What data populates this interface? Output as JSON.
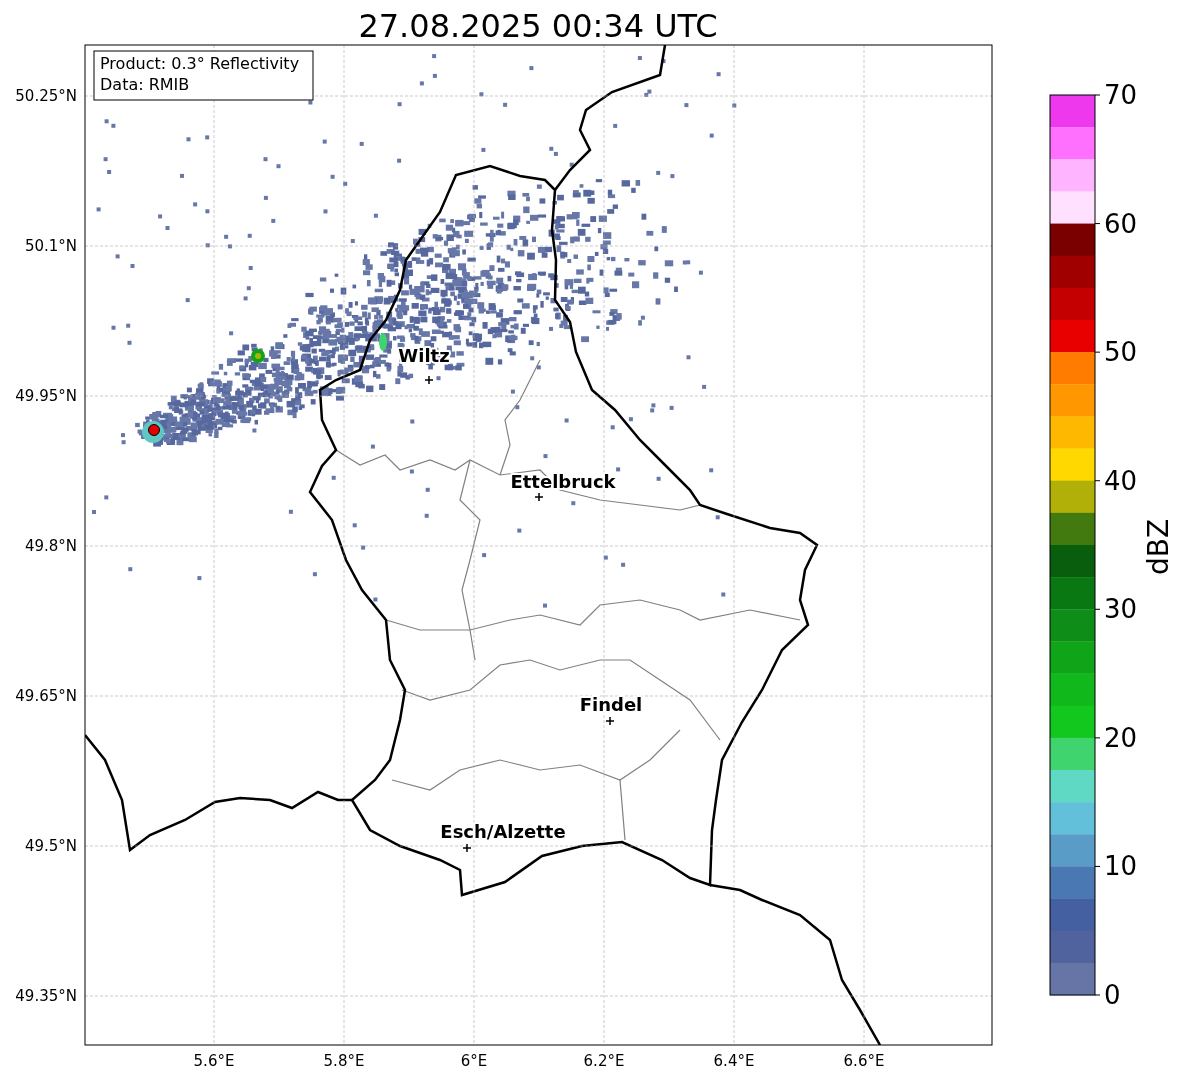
{
  "title": "27.08.2025 00:34 UTC",
  "legend": [
    "Product: 0.3° Reflectivity",
    "Data: RMIB"
  ],
  "map": {
    "lat_ticks": [
      "50.25°N",
      "50.1°N",
      "49.95°N",
      "49.8°N",
      "49.65°N",
      "49.5°N",
      "49.35°N"
    ],
    "lon_ticks": [
      "5.6°E",
      "5.8°E",
      "6°E",
      "6.2°E",
      "6.4°E",
      "6.6°E"
    ],
    "cities": [
      {
        "name": "Wiltz"
      },
      {
        "name": "Ettelbruck"
      },
      {
        "name": "Findel"
      },
      {
        "name": "Esch/Alzette"
      }
    ]
  },
  "colorbar": {
    "label": "dBZ",
    "ticks": [
      "70",
      "60",
      "50",
      "40",
      "30",
      "20",
      "10",
      "0"
    ],
    "bands": [
      {
        "color": "#ee38ee"
      },
      {
        "color": "#ff70ff"
      },
      {
        "color": "#ffb4ff"
      },
      {
        "color": "#ffe0ff"
      },
      {
        "color": "#7a0000"
      },
      {
        "color": "#a00000"
      },
      {
        "color": "#c40000"
      },
      {
        "color": "#e80000"
      },
      {
        "color": "#ff7c00"
      },
      {
        "color": "#ff9800"
      },
      {
        "color": "#ffb800"
      },
      {
        "color": "#ffd800"
      },
      {
        "color": "#b0b008"
      },
      {
        "color": "#437a10"
      },
      {
        "color": "#085e0c"
      },
      {
        "color": "#0a7812"
      },
      {
        "color": "#0e8e18"
      },
      {
        "color": "#10a418"
      },
      {
        "color": "#10b81c"
      },
      {
        "color": "#12c81e"
      },
      {
        "color": "#3fd46e"
      },
      {
        "color": "#5fd8c4"
      },
      {
        "color": "#62c0da"
      },
      {
        "color": "#5a9cc8"
      },
      {
        "color": "#4a78b2"
      },
      {
        "color": "#4460a0"
      },
      {
        "color": "#50639e"
      },
      {
        "color": "#6674a6"
      }
    ]
  }
}
